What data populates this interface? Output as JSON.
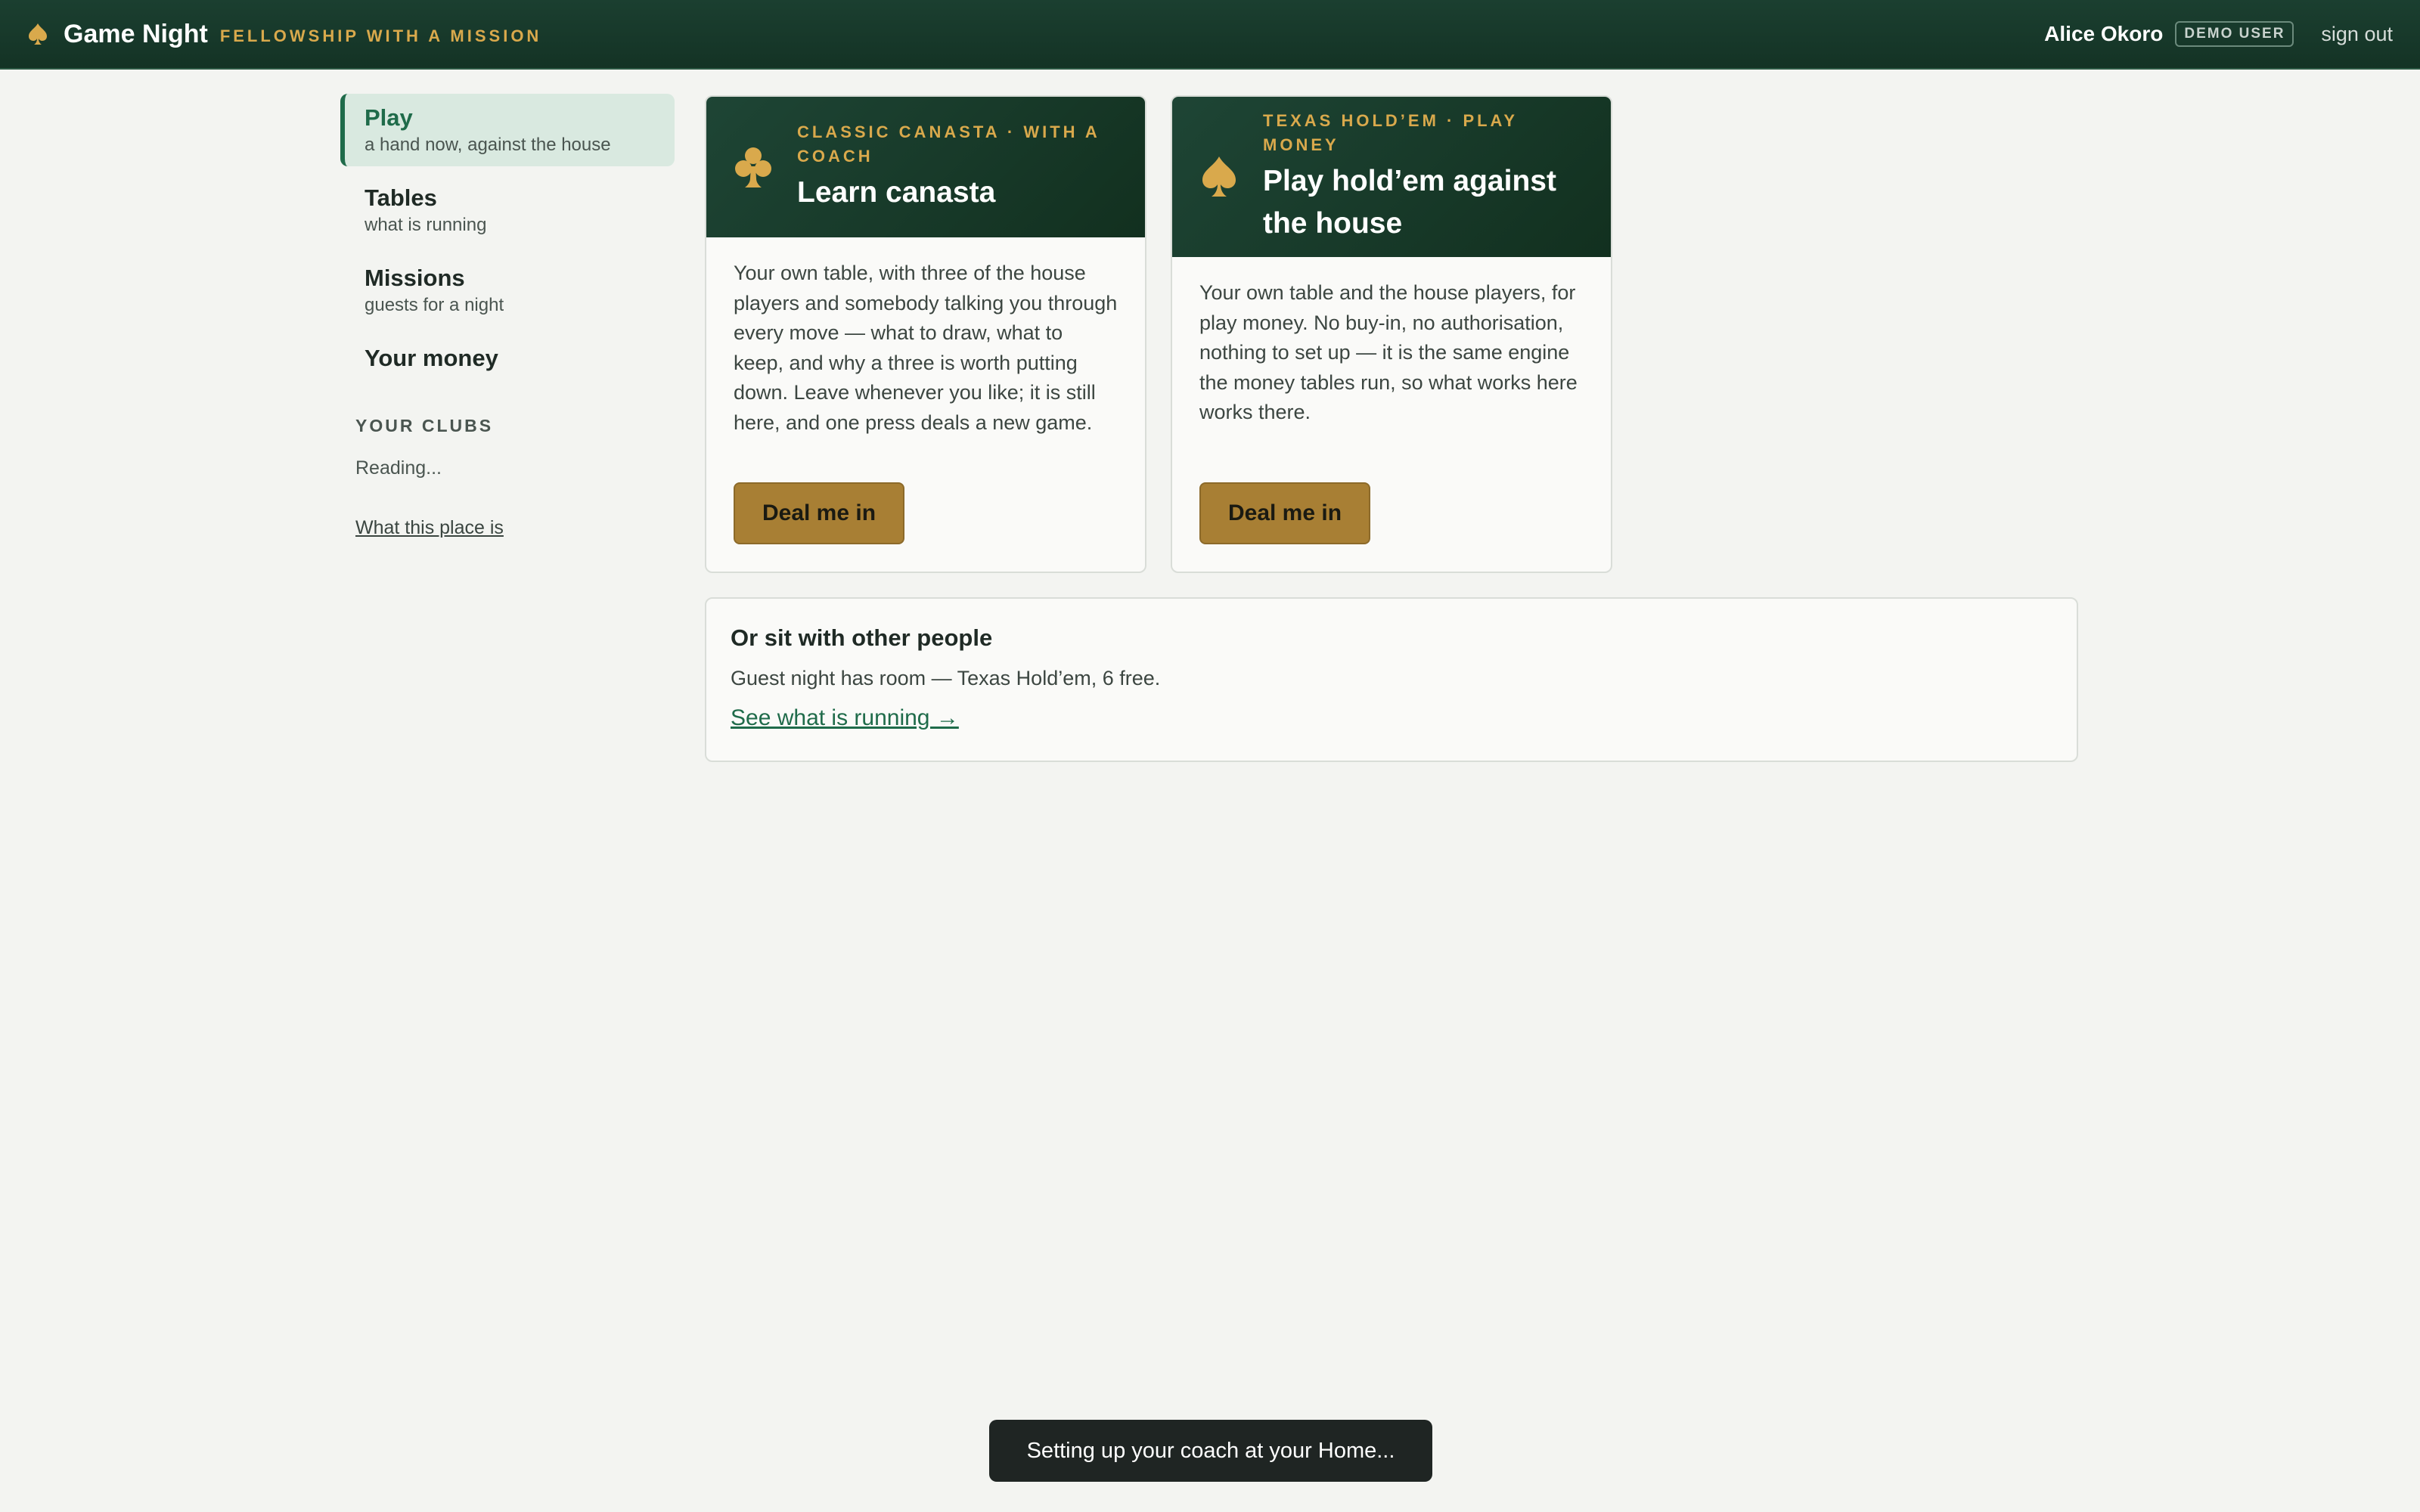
{
  "header": {
    "brand_name": "Game Night",
    "brand_tagline": "FELLOWSHIP WITH A MISSION",
    "user_name": "Alice Okoro",
    "user_badge": "DEMO USER",
    "signout_label": "sign out"
  },
  "sidebar": {
    "items": [
      {
        "label": "Play",
        "sub": "a hand now, against the house",
        "active": true
      },
      {
        "label": "Tables",
        "sub": "what is running"
      },
      {
        "label": "Missions",
        "sub": "guests for a night"
      },
      {
        "label": "Your money",
        "sub": ""
      }
    ],
    "clubs_heading": "YOUR CLUBS",
    "clubs_status": "Reading...",
    "about_link": "What this place is"
  },
  "cards": [
    {
      "kicker": "CLASSIC CANASTA · WITH A COACH",
      "title": "Learn canasta",
      "icon": "club-icon",
      "body": "Your own table, with three of the house players and somebody talking you through every move — what to draw, what to keep, and why a three is worth putting down. Leave whenever you like; it is still here, and one press deals a new game.",
      "button": "Deal me in"
    },
    {
      "kicker": "TEXAS HOLD’EM · PLAY MONEY",
      "title": "Play hold’em against the house",
      "icon": "spade-icon",
      "body": "Your own table and the house players, for play money. No buy-in, no authorisation, nothing to set up — it is the same engine the money tables run, so what works here works there.",
      "button": "Deal me in"
    }
  ],
  "others": {
    "title": "Or sit with other people",
    "text": "Guest night has room — Texas Hold’em, 6 free.",
    "link": "See what is running →"
  },
  "toast": {
    "text": "Setting up your coach at your Home..."
  },
  "colors": {
    "header_bg": "#1b3f30",
    "accent_gold": "#d9a94c",
    "button_gold": "#a87f34",
    "active_nav_bg": "#d9e9e0",
    "link_green": "#1f6b4a"
  }
}
